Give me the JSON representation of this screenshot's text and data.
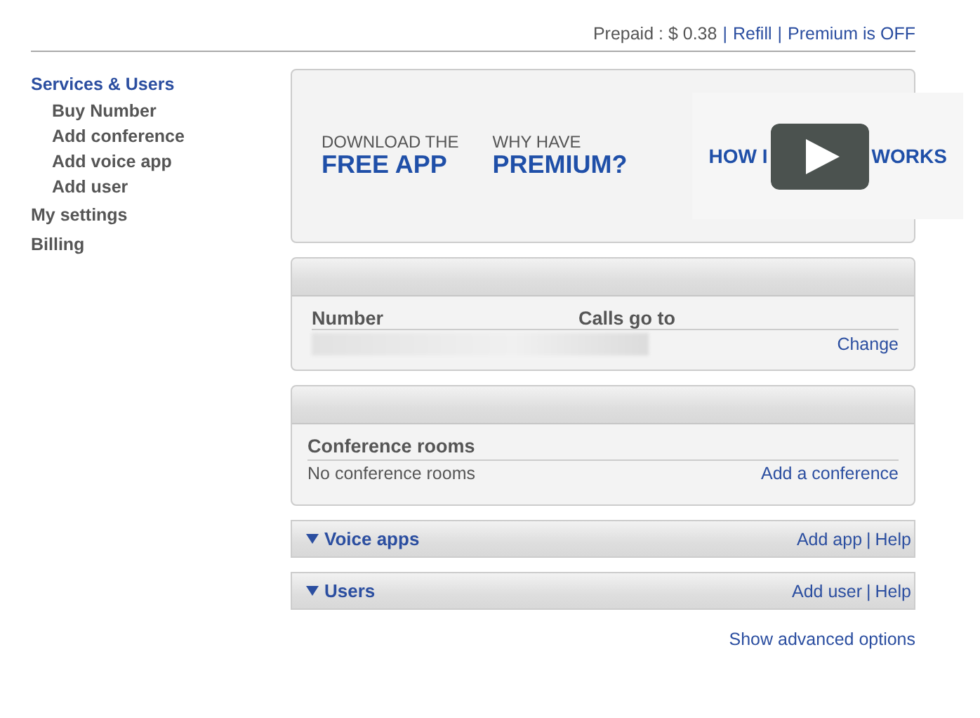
{
  "header": {
    "prepaid": "Prepaid : $ 0.38",
    "links": [
      "Refill",
      "Premium is OFF"
    ],
    "separator": "|"
  },
  "sidebar": {
    "items": [
      {
        "label": "Services & Users",
        "selected": true,
        "children": [
          {
            "label": "Buy Number"
          },
          {
            "label": "Add conference"
          },
          {
            "label": "Add voice app"
          },
          {
            "label": "Add user"
          }
        ]
      },
      {
        "label": "My settings",
        "selected": false
      },
      {
        "label": "Billing",
        "selected": false
      }
    ]
  },
  "banner": {
    "promos": [
      {
        "small": "DOWNLOAD THE",
        "big": "FREE APP"
      },
      {
        "small": "WHY HAVE",
        "big": "PREMIUM?"
      }
    ],
    "video_text_before": "HOW I",
    "video_text_after": "WORKS"
  },
  "number_panel": {
    "columns": [
      "Number",
      "Calls go to"
    ],
    "action": "Change"
  },
  "conference_panel": {
    "title": "Conference rooms",
    "empty": "No conference rooms",
    "action": "Add a conference"
  },
  "sections": [
    {
      "title": "Voice apps",
      "expanded": true,
      "links": [
        "Add app",
        "Help"
      ],
      "separator": "|"
    },
    {
      "title": "Users",
      "expanded": true,
      "links": [
        "Add user",
        "Help"
      ],
      "separator": "|"
    }
  ],
  "advanced_link": "Show advanced options"
}
